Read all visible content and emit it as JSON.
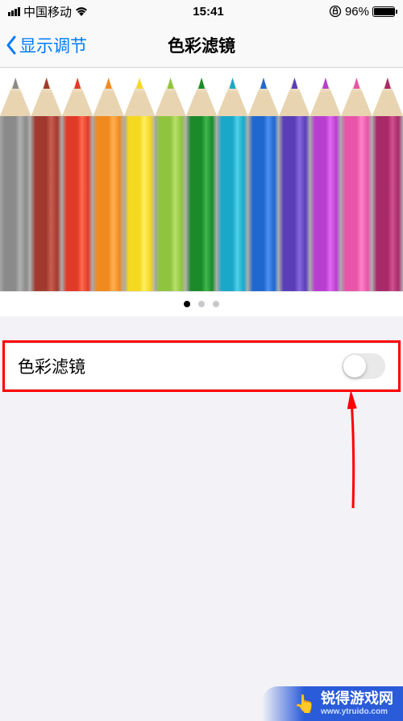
{
  "status": {
    "carrier": "中国移动",
    "time": "15:41",
    "battery_pct": "96%"
  },
  "nav": {
    "back_label": "显示调节",
    "title": "色彩滤镜"
  },
  "pencils": [
    {
      "color": "#8a8a8a",
      "light": "#b0b0b0"
    },
    {
      "color": "#a13a2e",
      "light": "#c86050"
    },
    {
      "color": "#e23a28",
      "light": "#ff6a4e"
    },
    {
      "color": "#f08a1e",
      "light": "#ffb050"
    },
    {
      "color": "#f5d820",
      "light": "#fff060"
    },
    {
      "color": "#8fc53e",
      "light": "#b8e068"
    },
    {
      "color": "#1a8a2a",
      "light": "#3eb84e"
    },
    {
      "color": "#1aa8c8",
      "light": "#50d0e8"
    },
    {
      "color": "#1e68d0",
      "light": "#4e90f0"
    },
    {
      "color": "#5a3eb8",
      "light": "#8868e0"
    },
    {
      "color": "#b83ed0",
      "light": "#e068f0"
    },
    {
      "color": "#e855a8",
      "light": "#ff80c8"
    },
    {
      "color": "#a82a68",
      "light": "#d05090"
    }
  ],
  "pager": {
    "pages": 3,
    "active": 0
  },
  "cell": {
    "label": "色彩滤镜",
    "on": false
  },
  "watermark": {
    "text": "锐得游戏网",
    "url": "www.ytruido.com"
  }
}
